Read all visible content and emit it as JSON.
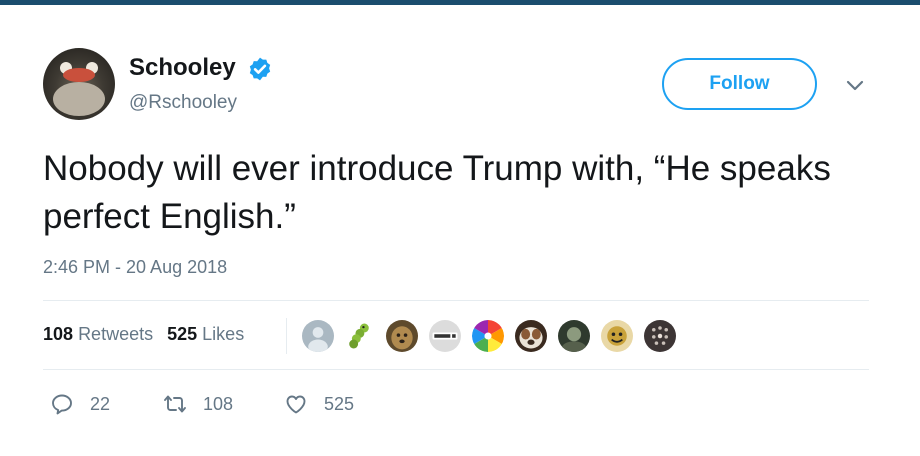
{
  "tweet": {
    "author_name": "Schooley",
    "author_handle": "@Rschooley",
    "verified": true,
    "text": "Nobody will ever introduce Trump with, “He speaks perfect English.”",
    "timestamp": "2:46 PM - 20 Aug 2018"
  },
  "follow_button": {
    "label": "Follow"
  },
  "stats": {
    "retweets_count": "108",
    "retweets_label": "Retweets",
    "likes_count": "525",
    "likes_label": "Likes"
  },
  "likers": [
    {
      "icon": "default-user-avatar",
      "color": "#aab8c2"
    },
    {
      "icon": "caterpillar-avatar",
      "color": "#8bbf3c"
    },
    {
      "icon": "dog-avatar",
      "color": "#8a6a3a"
    },
    {
      "icon": "wwwdi-logo-avatar",
      "color": "#d9d9d9"
    },
    {
      "icon": "rainbow-wheel-avatar",
      "color": "#e0409a"
    },
    {
      "icon": "bulldog-avatar",
      "color": "#7a4a2e"
    },
    {
      "icon": "photo-avatar",
      "color": "#3b4a3a"
    },
    {
      "icon": "cartoon-avatar",
      "color": "#c9a23a"
    },
    {
      "icon": "dotted-avatar",
      "color": "#4a4040"
    }
  ],
  "actions": {
    "reply_count": "22",
    "retweet_count": "108",
    "like_count": "525"
  },
  "colors": {
    "accent": "#1da1f2",
    "secondary_text": "#657786",
    "primary_text": "#14171a",
    "top_bar": "#1b4d6e"
  }
}
